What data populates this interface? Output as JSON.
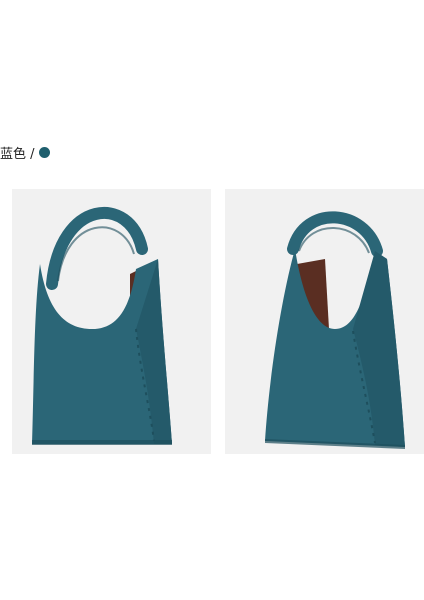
{
  "variant": {
    "label": "蓝色 /",
    "swatch_color": "#1f5f6e"
  },
  "bag": {
    "color": "#2b6677",
    "shade": "#1e4f5d",
    "interior": "#5a2e22",
    "background": "#f1f1f1"
  }
}
